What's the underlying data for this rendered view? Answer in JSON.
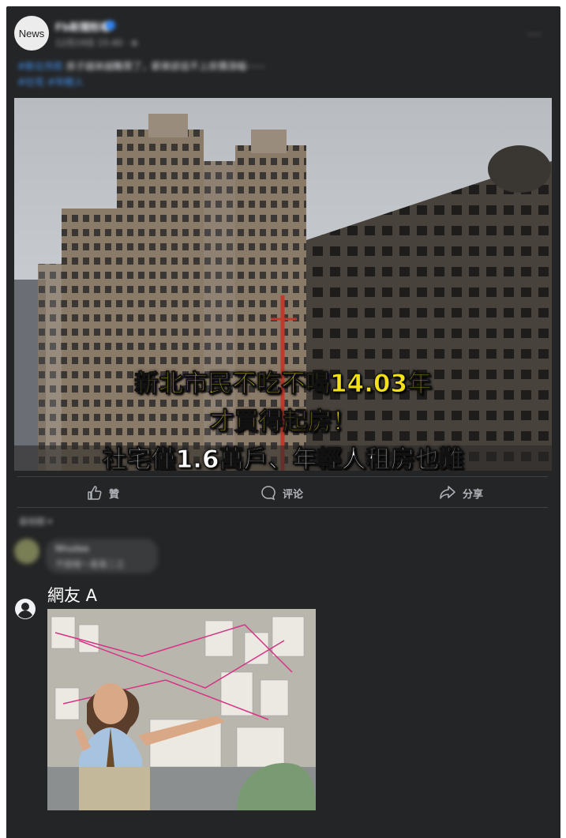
{
  "post": {
    "avatar_label": "News",
    "page_name": "Fb新聞粉專",
    "post_time": "12月19日 15:40 · ⊕",
    "more": "···",
    "caption_tag": "#新北市民",
    "caption_text": "房子越來越難買了，薪資卻追不上房價漲幅⋯⋯",
    "caption_link": "#社宅 #年輕人"
  },
  "image_text": {
    "line1": "新北市民不吃不喝14.03年",
    "line2": "才買得起房！",
    "line3": "社宅僅1.6萬戶、年輕人租房也難"
  },
  "actions": {
    "like": "贊",
    "comment": "评论",
    "share": "分享"
  },
  "comments": {
    "sort_label": "最相關 ▾",
    "blurred_name": "Nhudaa",
    "blurred_text": "不錯喔～看看二之",
    "user_name": "網友 A"
  },
  "icons": {
    "like": "thumbs-up-icon",
    "comment": "speech-bubble-icon",
    "share": "share-arrow-icon",
    "user": "user-silhouette-icon",
    "more": "ellipsis-icon"
  },
  "colors": {
    "card_bg": "#242526",
    "text_primary": "#e4e6eb",
    "text_secondary": "#b0b3b8",
    "link": "#4599ff",
    "headline_yellow": "#f5e11a"
  }
}
